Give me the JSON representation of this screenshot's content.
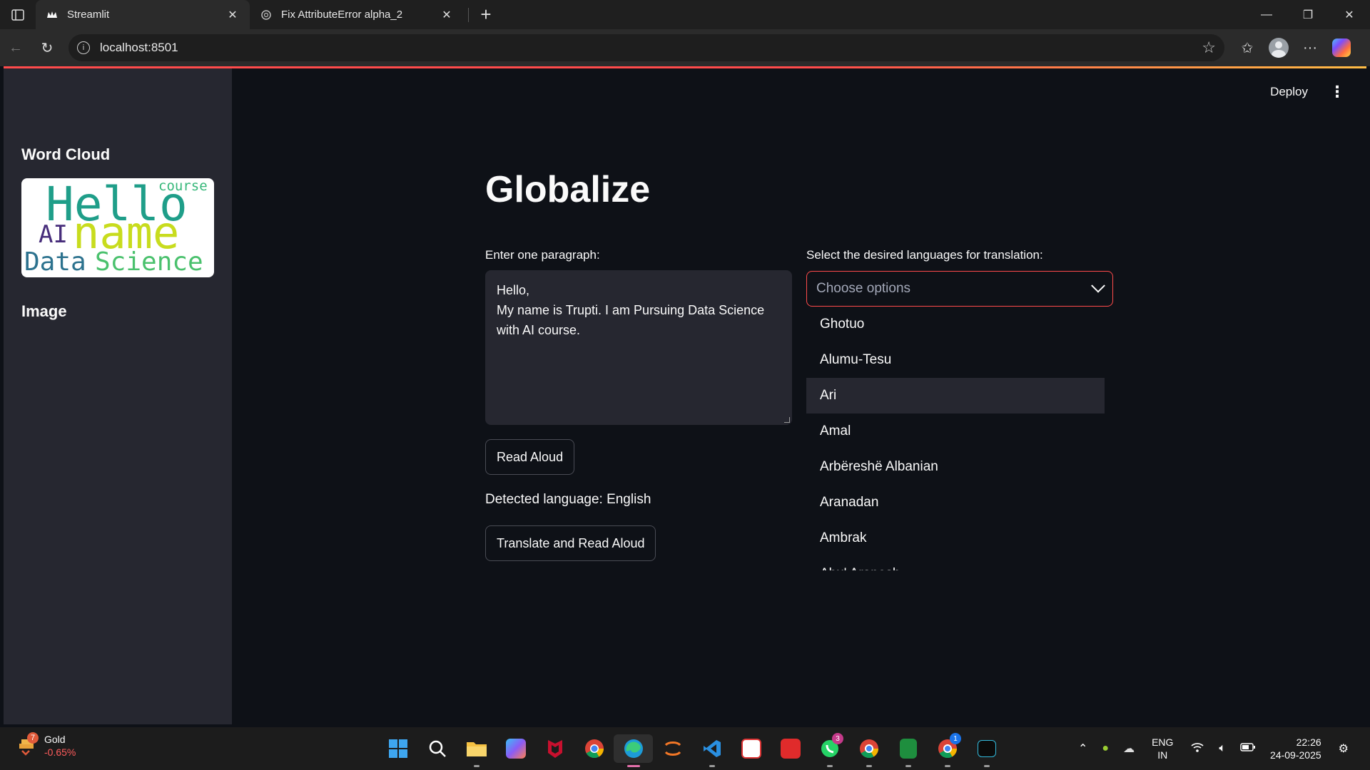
{
  "browser": {
    "tabs": [
      {
        "title": "Streamlit",
        "active": true
      },
      {
        "title": "Fix AttributeError alpha_2",
        "active": false
      }
    ],
    "url": "localhost:8501"
  },
  "app": {
    "header": {
      "deploy_label": "Deploy"
    },
    "sidebar": {
      "word_cloud_heading": "Word Cloud",
      "image_heading": "Image",
      "word_cloud_words": [
        "Hello",
        "name",
        "AI",
        "course",
        "Data",
        "Science"
      ]
    },
    "title": "Globalize",
    "input": {
      "label": "Enter one paragraph:",
      "value": "Hello,\nMy name is Trupti. I am Pursuing Data Science with AI course."
    },
    "read_aloud_label": "Read Aloud",
    "detected_language": "Detected language: English",
    "translate_label": "Translate and Read Aloud",
    "multiselect": {
      "label": "Select the desired languages for translation:",
      "placeholder": "Choose options",
      "options": [
        "Ghotuo",
        "Alumu-Tesu",
        "Ari",
        "Amal",
        "Arbëreshë Albanian",
        "Aranadan",
        "Ambrak",
        "Abu' Arapesh"
      ],
      "highlighted_index": 2
    }
  },
  "taskbar": {
    "weather": {
      "title": "Gold",
      "value": "-0.65%",
      "badge": "7"
    },
    "badges": {
      "whatsapp": "3",
      "chrome": "1"
    },
    "language": {
      "line1": "ENG",
      "line2": "IN"
    },
    "time": "22:26",
    "date": "24-09-2025"
  },
  "colors": {
    "accent": "#ff4b4b",
    "background": "#0e1117",
    "sidebar": "#262730"
  }
}
